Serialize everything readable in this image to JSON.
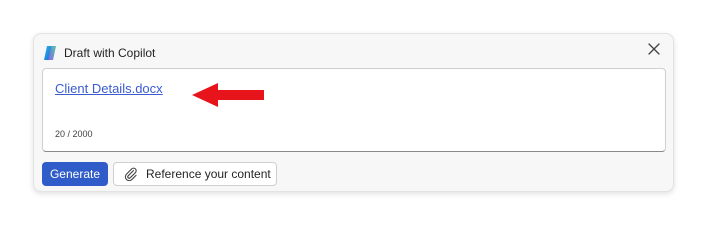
{
  "dialog": {
    "title": "Draft with Copilot",
    "close_icon": "close-icon"
  },
  "editor": {
    "attachment_link": "Client Details.docx",
    "char_counter": "20 / 2000"
  },
  "actions": {
    "generate_label": "Generate",
    "reference_label": "Reference your content",
    "reference_icon": "paperclip-icon"
  },
  "annotation": {
    "arrow_color": "#e8141c"
  },
  "colors": {
    "primary": "#2f5cc8",
    "link": "#3b5bd1"
  }
}
